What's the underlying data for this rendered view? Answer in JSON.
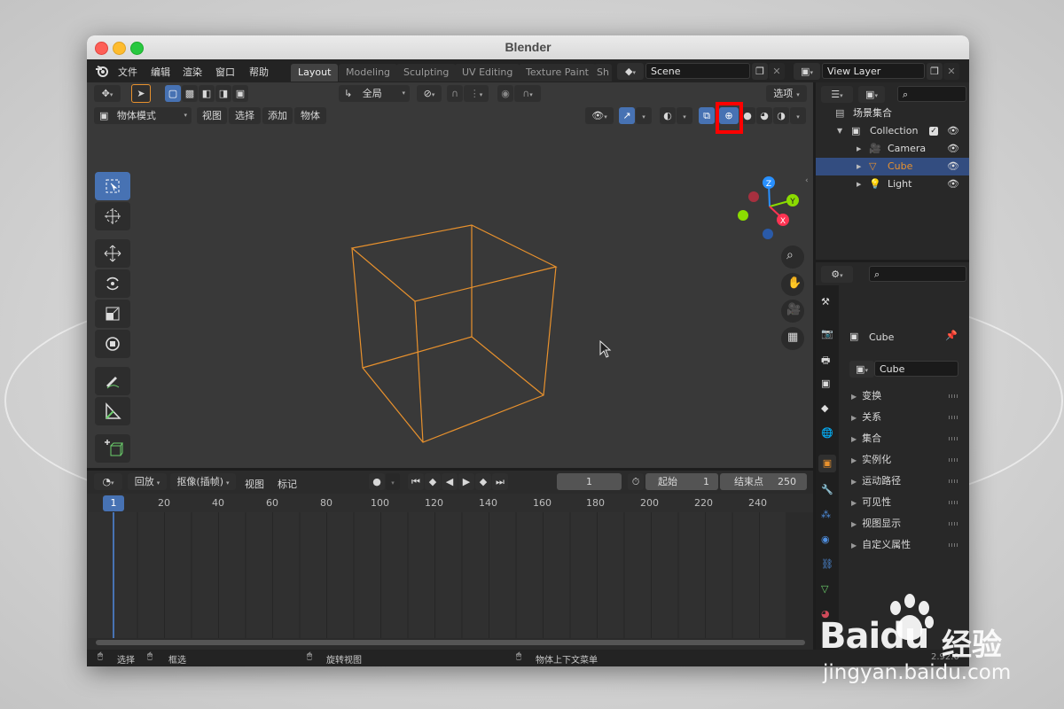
{
  "window": {
    "title": "Blender"
  },
  "menu": [
    "文件",
    "编辑",
    "渲染",
    "窗口",
    "帮助"
  ],
  "workspace_tabs": [
    "Layout",
    "Modeling",
    "Sculpting",
    "UV Editing",
    "Texture Paint",
    "Sh"
  ],
  "scene_field": "Scene",
  "view_layer_field": "View Layer",
  "viewport_header": {
    "orientation": "全局",
    "options_label": "选项",
    "mode": "物体模式",
    "menus": [
      "视图",
      "选择",
      "添加",
      "物体"
    ]
  },
  "outliner": {
    "root": "场景集合",
    "collection": "Collection",
    "items": [
      "Camera",
      "Cube",
      "Light"
    ]
  },
  "properties": {
    "object_name": "Cube",
    "datablock": "Cube",
    "sections": [
      "变换",
      "关系",
      "集合",
      "实例化",
      "运动路径",
      "可见性",
      "视图显示",
      "自定义属性"
    ]
  },
  "timeline": {
    "playback": "回放",
    "keying": "抠像(插帧)",
    "view": "视图",
    "marker": "标记",
    "current_frame": "1",
    "start_label": "起始",
    "start_value": "1",
    "end_label": "结束点",
    "end_value": "250",
    "ruler_current": "1",
    "ruler": [
      "20",
      "40",
      "60",
      "80",
      "100",
      "120",
      "140",
      "160",
      "180",
      "200",
      "220",
      "240"
    ]
  },
  "statusbar": {
    "select": "选择",
    "box_select": "框选",
    "rotate": "旋转视图",
    "context_menu": "物体上下文菜单",
    "version": "2.92.0"
  },
  "watermark": {
    "brand": "Baidu",
    "product": "经验",
    "url": "jingyan.baidu.com"
  },
  "colors": {
    "accent": "#4772b3",
    "selection_wire": "#e8912d",
    "highlight_box": "#ff0000",
    "axis_x": "#ff3352",
    "axis_y": "#8bdc00",
    "axis_z": "#2890ff"
  }
}
